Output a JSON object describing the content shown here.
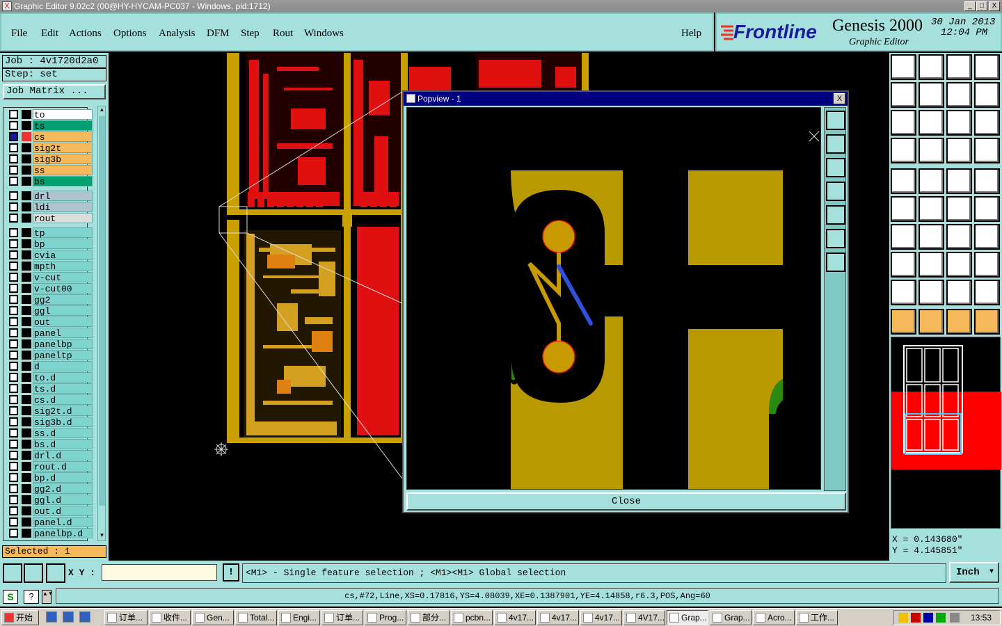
{
  "window": {
    "title": "Graphic Editor 9.02c2 (00@HY-HYCAM-PC037 - Windows, pid:1712)",
    "min": "_",
    "max": "□",
    "close": "X"
  },
  "menu": {
    "items": [
      "File",
      "Edit",
      "Actions",
      "Options",
      "Analysis",
      "DFM",
      "Step",
      "Rout",
      "Windows"
    ],
    "help": "Help"
  },
  "brand": {
    "logo": "Frontline",
    "product": "Genesis 2000",
    "subtitle": "Graphic Editor",
    "date": "30 Jan 2013",
    "time": "12:04 PM"
  },
  "job": {
    "job_label": "Job : 4v1720d2a0",
    "step_label": "Step: set",
    "job_matrix": "Job Matrix ..."
  },
  "layers": {
    "group1": [
      {
        "name": "to",
        "color": "#ffffff"
      },
      {
        "name": "ts",
        "color": "#00a070"
      },
      {
        "name": "cs",
        "color": "#f5b85a"
      },
      {
        "name": "sig2t",
        "color": "#f5b85a"
      },
      {
        "name": "sig3b",
        "color": "#f5b85a"
      },
      {
        "name": "ss",
        "color": "#f5b85a"
      },
      {
        "name": "bs",
        "color": "#00a070"
      }
    ],
    "group2": [
      {
        "name": "drl",
        "color": "#b0c4d0"
      },
      {
        "name": "ldi",
        "color": "#b0c4d0"
      },
      {
        "name": "rout",
        "color": "#dcdcdc"
      }
    ],
    "group3": [
      "tp",
      "bp",
      "cvia",
      "mpth",
      "v-cut",
      "v-cut00",
      "gg2",
      "ggl",
      "out",
      "panel",
      "panelbp",
      "paneltp",
      "d",
      "to.d",
      "ts.d",
      "cs.d",
      "sig2t.d",
      "sig3b.d",
      "ss.d",
      "bs.d",
      "drl.d",
      "rout.d",
      "bp.d",
      "gg2.d",
      "ggl.d",
      "out.d",
      "panel.d",
      "panelbp.d"
    ],
    "selected": "Selected : 1"
  },
  "popup": {
    "title": "Popview - 1",
    "close_label": "Close",
    "close_x": "X"
  },
  "coords": {
    "x": "X = 0.143680\"",
    "y": "Y = 4.145851\""
  },
  "status": {
    "xy_label": "X Y :",
    "xy_value": "",
    "excl": "!",
    "hint": "<M1> - Single feature selection ; <M1><M1> Global selection",
    "units": "Inch",
    "feature": "cs,#72,Line,XS=0.17816,YS=4.08039,XE=0.1387901,YE=4.14858,r6.3,POS,Ang=60"
  },
  "taskbar": {
    "start": "开始",
    "items": [
      "订单...",
      "收件...",
      "Gen...",
      "Total...",
      "Engi...",
      "订单...",
      "Prog...",
      "部分...",
      "pcbn...",
      "4v17...",
      "4v17...",
      "4v17...",
      "4V17...",
      "Grap...",
      "Grap...",
      "Acro...",
      "工作..."
    ],
    "clock": "13:53"
  }
}
